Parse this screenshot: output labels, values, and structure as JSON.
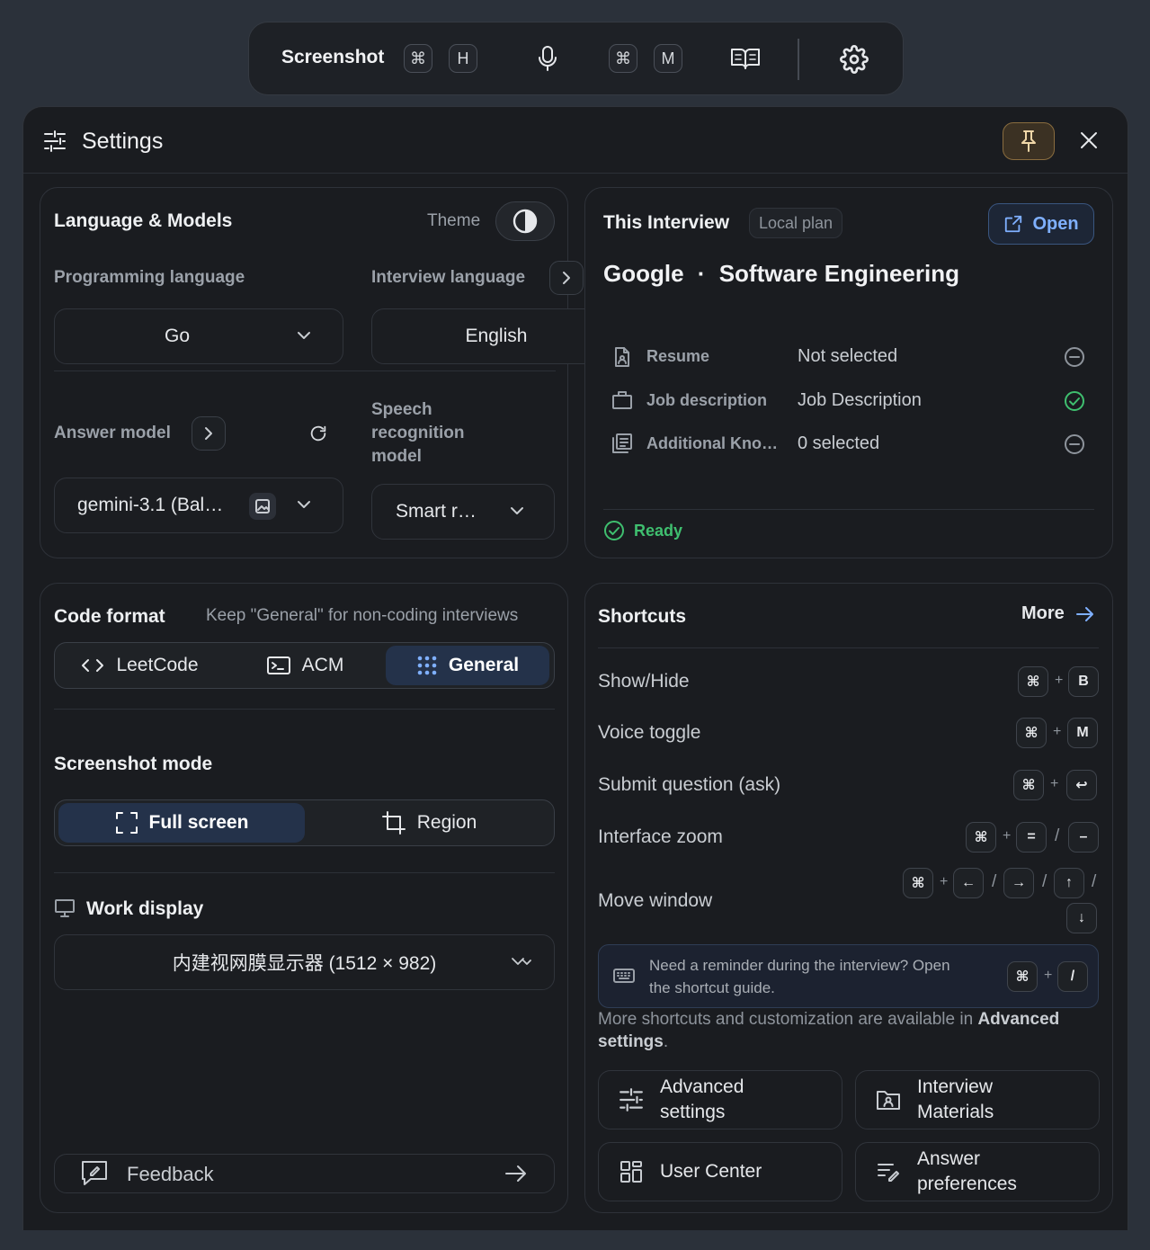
{
  "toolbar": {
    "title": "Screenshot",
    "keys_screenshot": [
      "⌘",
      "H"
    ],
    "keys_voice": [
      "⌘",
      "M"
    ]
  },
  "panel": {
    "title": "Settings"
  },
  "lang_models": {
    "title": "Language & Models",
    "theme_label": "Theme",
    "programming_language_label": "Programming language",
    "programming_language_value": "Go",
    "interview_language_label": "Interview language",
    "interview_language_value": "English",
    "answer_model_label": "Answer model",
    "answer_model_value": "gemini-3.1 (Bal…",
    "speech_model_label": [
      "Speech",
      "recognition",
      "model"
    ],
    "speech_model_value": "Smart r…"
  },
  "interview": {
    "title": "This Interview",
    "plan_badge": "Local plan",
    "open_label": "Open",
    "company": "Google",
    "separator": "·",
    "role": "Software Engineering",
    "rows": [
      {
        "label": "Resume",
        "value": "Not selected",
        "status": "empty"
      },
      {
        "label": "Job description",
        "value": "Job Description",
        "status": "ok"
      },
      {
        "label": "Additional Kno…",
        "value": "0 selected",
        "status": "empty"
      }
    ],
    "status": "Ready",
    "colors": {
      "ok": "#3fbf6f",
      "accent": "#6ea2ff"
    }
  },
  "code_format": {
    "title": "Code format",
    "hint": "Keep \"General\" for non-coding interviews",
    "options": [
      "LeetCode",
      "ACM",
      "General"
    ],
    "selected": "General"
  },
  "screenshot_mode": {
    "title": "Screenshot mode",
    "options": [
      "Full screen",
      "Region"
    ],
    "selected": "Full screen"
  },
  "work_display": {
    "title": "Work display",
    "value": "内建视网膜显示器 (1512 × 982)"
  },
  "feedback": {
    "label": "Feedback"
  },
  "shortcuts": {
    "title": "Shortcuts",
    "more_label": "More",
    "items": [
      {
        "label": "Show/Hide"
      },
      {
        "label": "Voice toggle"
      },
      {
        "label": "Submit question (ask)"
      },
      {
        "label": "Interface zoom"
      },
      {
        "label": "Move window"
      }
    ],
    "keys": {
      "cmd": "⌘",
      "plus": "+",
      "slash": "/",
      "b": "B",
      "m": "M",
      "enter": "↩",
      "eq": "=",
      "minus": "–",
      "left": "←",
      "right": "→",
      "up": "↑",
      "down": "↓"
    },
    "reminder_line1": "Need a reminder during the interview? Open",
    "reminder_line2": "the shortcut guide.",
    "more_text": "More shortcuts and customization are available in",
    "more_text_bold": "Advanced settings",
    "more_text_end": ".",
    "buttons": {
      "advanced_1": "Advanced",
      "advanced_2": "settings",
      "materials_1": "Interview",
      "materials_2": "Materials",
      "user_center": "User Center",
      "answer_1": "Answer",
      "answer_2": "preferences"
    }
  }
}
